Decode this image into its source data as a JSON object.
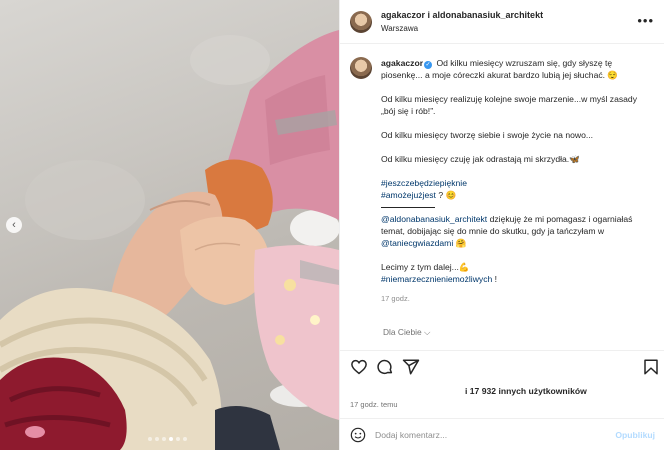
{
  "header": {
    "username_line": "agakaczor i aldonabanasiuk_architekt",
    "location": "Warszawa",
    "more_label": "•••"
  },
  "caption": {
    "username": "agakaczor",
    "text1": "Od kilku miesięcy wzruszam się, gdy słyszę tę piosenkę... a moje córeczki akurat bardzo lubią jej słuchać. 😌",
    "text2": "Od kilku miesięcy realizuję kolejne swoje marzenie...w myśl zasady „bój się i rób!”.",
    "text3": "Od kilku miesięcy tworzę siebie i swoje życie na nowo...",
    "text4": "Od kilku miesięcy czuję jak odrastają mi skrzydła.🦋",
    "hashtag1": "#jeszczebędziepięknie",
    "hashtag2": "#amożejużjest",
    "hashtag2_suffix": " ? 😊",
    "mention1": "@aldonabanasiuk_architekt",
    "mention_text": " dziękuję że mi pomagasz i ogarniałaś temat, dobijając się do mnie do skutku, gdy ja tańczyłam w ",
    "mention2": "@taniecgwiazdami",
    "mention2_suffix": " 🤗",
    "text5": "Lecimy z tym dalej...💪",
    "hashtag3": "#niemarzecznieniemożliwych",
    "hashtag3_suffix": " !",
    "time": "17 godz.",
    "for_you": "Dla Ciebie ⌵"
  },
  "likes_text": "i 17 932 innych użytkowników",
  "post_time": "17 godz. temu",
  "comment_input": {
    "placeholder": "Dodaj komentarz...",
    "publish_label": "Opublikuj"
  },
  "carousel": {
    "dot_count": 6,
    "active_index": 3
  },
  "icons": [
    "heart-icon",
    "comment-icon",
    "share-icon",
    "bookmark-icon",
    "emoji-icon",
    "more-icon",
    "chevron-left-icon",
    "verified-icon"
  ],
  "colors": {
    "link": "#00376b",
    "verified": "#3897f0",
    "publish": "#b3dbff",
    "muted": "#8e8e8e"
  }
}
